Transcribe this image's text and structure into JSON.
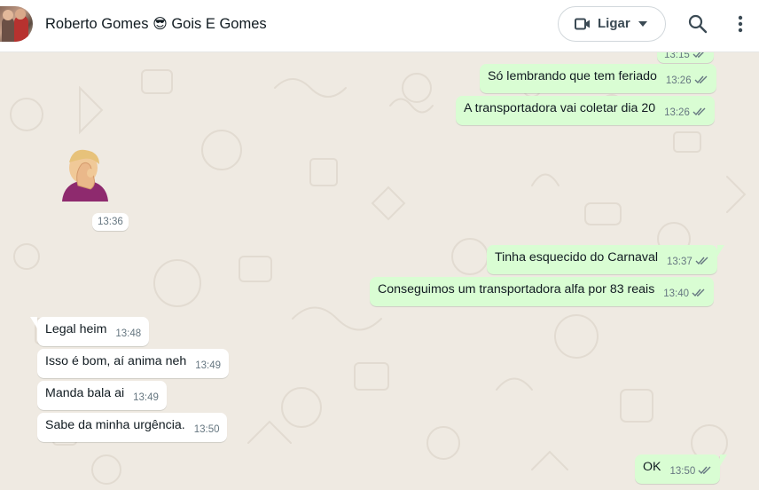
{
  "header": {
    "contact_name": "Roberto Gomes",
    "emoji": "😎",
    "contact_suffix": "Gois E Gomes",
    "call_label": "Ligar",
    "icons": [
      "avatar",
      "video-icon",
      "chevron-down-icon",
      "search-icon",
      "menu-icon"
    ]
  },
  "messages": {
    "top_partial": {
      "time": "13:15",
      "status": "read"
    },
    "m1": {
      "text": "Só lembrando que tem feriado",
      "time": "13:26",
      "status": "read",
      "direction": "out"
    },
    "m2": {
      "text": "A transportadora vai coletar dia 20",
      "time": "13:26",
      "status": "read",
      "direction": "out"
    },
    "sticker": {
      "icon": "facepalm-sticker",
      "time": "13:36",
      "direction": "in"
    },
    "m3": {
      "text": "Tinha esquecido do Carnaval",
      "time": "13:37",
      "status": "read",
      "direction": "out"
    },
    "m4": {
      "text": "Conseguimos um transportadora alfa por 83 reais",
      "time": "13:40",
      "status": "read",
      "direction": "out"
    },
    "m5": {
      "text": "Legal heim",
      "time": "13:48",
      "direction": "in"
    },
    "m6": {
      "text": "Isso é bom, aí anima neh",
      "time": "13:49",
      "direction": "in"
    },
    "m7": {
      "text": "Manda bala ai",
      "time": "13:49",
      "direction": "in"
    },
    "m8": {
      "text": "Sabe da minha urgência.",
      "time": "13:50",
      "direction": "in"
    },
    "m9": {
      "text": "OK",
      "time": "13:50",
      "status": "read",
      "direction": "out"
    }
  },
  "colors": {
    "outgoing_bubble": "#d9fdd3",
    "incoming_bubble": "#ffffff",
    "chat_background": "#efeae2",
    "read_ticks": "#667781"
  }
}
